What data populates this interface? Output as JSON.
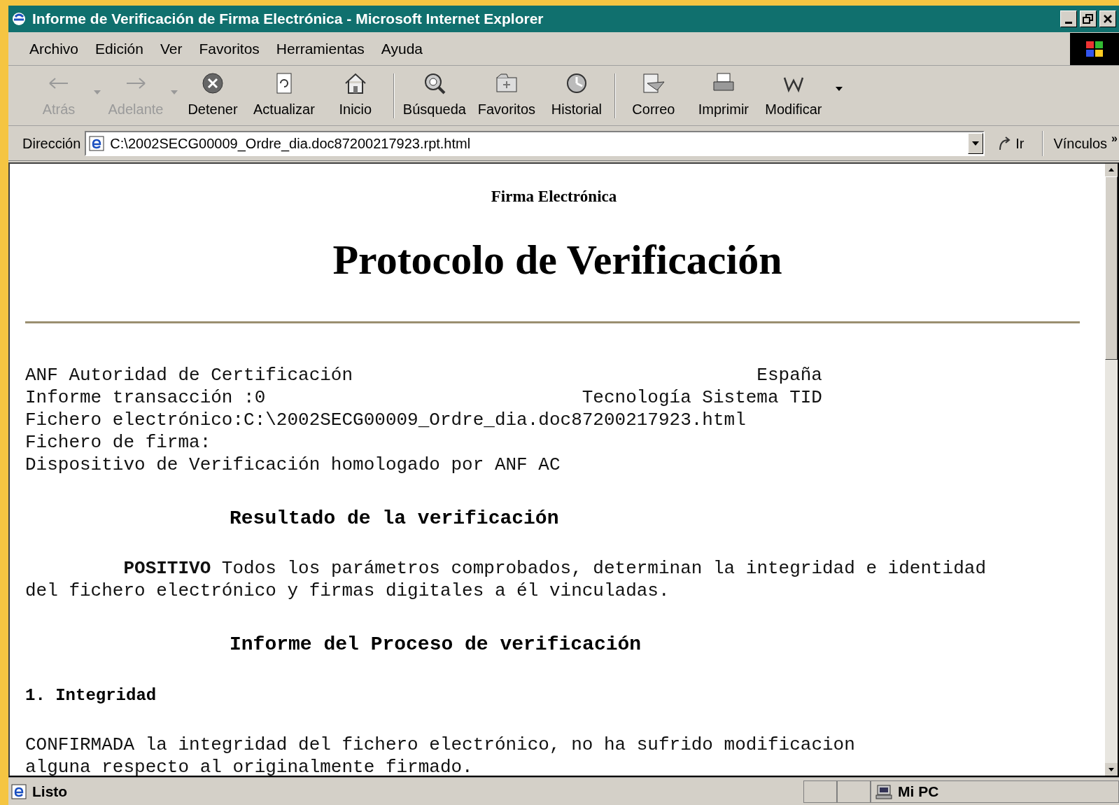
{
  "window": {
    "title": "Informe de Verificación de Firma Electrónica - Microsoft Internet Explorer"
  },
  "menu": [
    "Archivo",
    "Edición",
    "Ver",
    "Favoritos",
    "Herramientas",
    "Ayuda"
  ],
  "toolbar": [
    {
      "kind": "back",
      "label": "Atrás",
      "disabled": true,
      "dropdown": true
    },
    {
      "kind": "forward",
      "label": "Adelante",
      "disabled": true,
      "dropdown": true
    },
    {
      "kind": "stop",
      "label": "Detener",
      "disabled": false,
      "dropdown": false
    },
    {
      "kind": "refresh",
      "label": "Actualizar",
      "disabled": false,
      "dropdown": false
    },
    {
      "kind": "home",
      "label": "Inicio",
      "disabled": false,
      "dropdown": false
    },
    {
      "kind": "search",
      "label": "Búsqueda",
      "disabled": false,
      "dropdown": false
    },
    {
      "kind": "favorites",
      "label": "Favoritos",
      "disabled": false,
      "dropdown": false
    },
    {
      "kind": "history",
      "label": "Historial",
      "disabled": false,
      "dropdown": false
    },
    {
      "kind": "mail",
      "label": "Correo",
      "disabled": false,
      "dropdown": false
    },
    {
      "kind": "print",
      "label": "Imprimir",
      "disabled": false,
      "dropdown": false
    },
    {
      "kind": "edit",
      "label": "Modificar",
      "disabled": false,
      "dropdown": false
    }
  ],
  "address_bar": {
    "label": "Dirección",
    "value": "C:\\2002SECG00009_Ordre_dia.doc87200217923.rpt.html",
    "go": "Ir",
    "links": "Vínculos",
    "links_more": "»"
  },
  "document": {
    "subtitle": "Firma Electrónica",
    "title": "Protocolo de Verificación",
    "header_lines": [
      {
        "left": "ANF Autoridad de Certificación",
        "right": "España"
      },
      {
        "left": "Informe transacción :0",
        "right": "Tecnología Sistema TID"
      },
      {
        "left": "Fichero electrónico:C:\\2002SECG00009_Ordre_dia.doc87200217923.html"
      },
      {
        "left": "Fichero de firma:"
      },
      {
        "left": "Dispositivo de Verificación homologado por ANF AC"
      }
    ],
    "sections": [
      {
        "kind": "heading",
        "text": "Resultado de la verificación"
      },
      {
        "kind": "paragraph",
        "indent": true,
        "text": "**POSITIVO** Todos los parámetros comprobados, determinan la integridad e identidad del fichero electrónico y firmas digitales a él vinculadas."
      },
      {
        "kind": "heading",
        "text": "Informe del Proceso de verificación"
      },
      {
        "kind": "subheading",
        "text": "1. Integridad"
      },
      {
        "kind": "paragraph",
        "indent": false,
        "text": "CONFIRMADA la integridad del fichero electrónico, no ha sufrido modificacion alguna respecto al originalmente firmado."
      }
    ]
  },
  "status_bar": {
    "text": "Listo",
    "zone": "Mi PC"
  }
}
